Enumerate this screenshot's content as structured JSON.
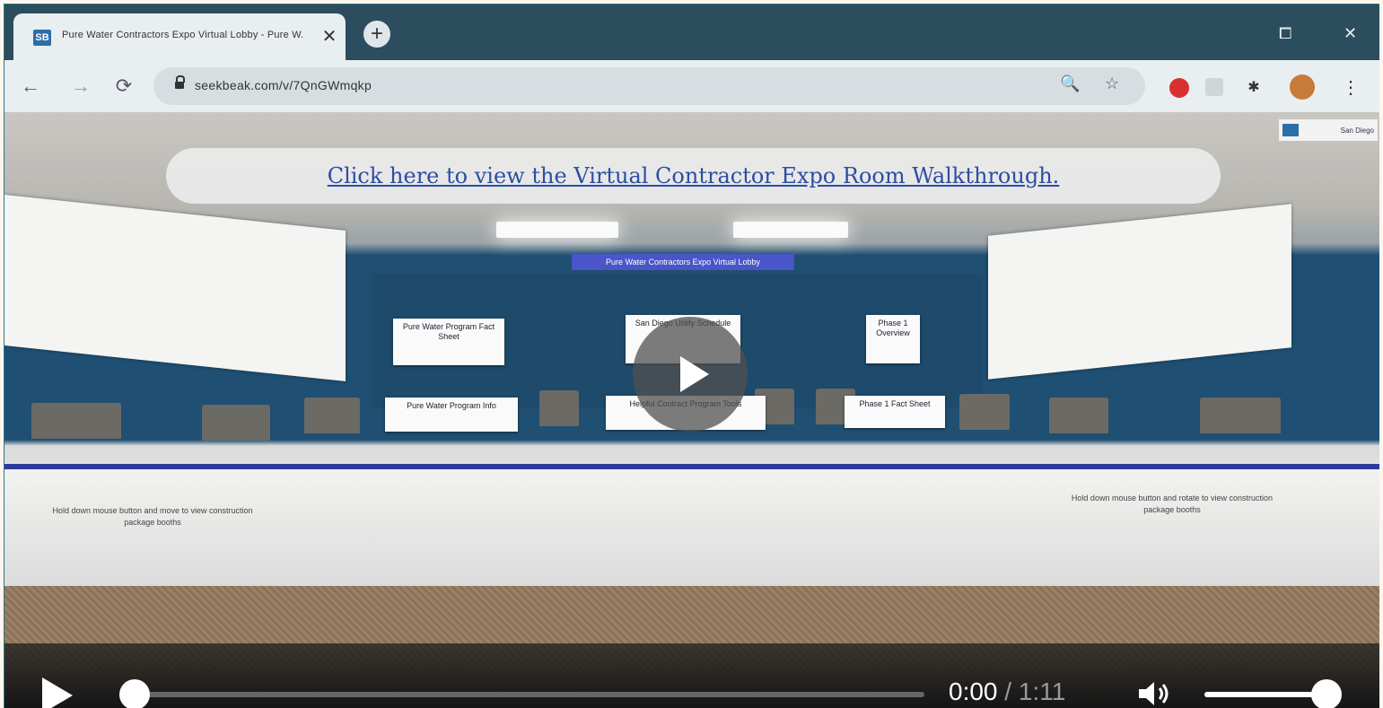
{
  "browser": {
    "tab": {
      "favicon_text": "SB",
      "title": "Pure Water Contractors Expo Virtual Lobby - Pure W..."
    },
    "new_tab": "+",
    "window_controls": {
      "restore": "⧠",
      "close": "✕"
    },
    "nav": {
      "back": "←",
      "forward": "→",
      "reload": "⟳"
    },
    "url": "seekbeak.com/v/7QnGWmqkp",
    "omnibox_icons": {
      "zoom": "🔍",
      "bookmark": "☆"
    },
    "extensions": [
      "adblock-icon",
      "extension-icon",
      "puzzle-icon",
      "profile-avatar",
      "menu-icon"
    ]
  },
  "video": {
    "link_text": "Click here to view the Virtual Contractor Expo Room Walkthrough.",
    "corner_logo_text": "San Diego",
    "banner": "Pure Water Contractors Expo Virtual Lobby",
    "signs": [
      {
        "text": "Pure Water Program Fact Sheet"
      },
      {
        "text": "San Diego Utility Schedule"
      },
      {
        "text": "Phase 1 Overview"
      },
      {
        "text": "Pure Water Program Info"
      },
      {
        "text": "Helpful Contract Program Tools"
      },
      {
        "text": "Phase 1 Fact Sheet"
      }
    ],
    "desk_notes": [
      "Hold down mouse button and move to view construction package booths",
      "Hold down mouse button and rotate to view construction package booths"
    ]
  },
  "controls": {
    "current_time": "0:00",
    "separator": " / ",
    "duration": "1:11",
    "progress": 0,
    "volume": 0.85
  },
  "colors": {
    "accent": "#2b4ea3",
    "tabstrip": "#2b4d5d",
    "toolbar": "#e9eef0"
  }
}
